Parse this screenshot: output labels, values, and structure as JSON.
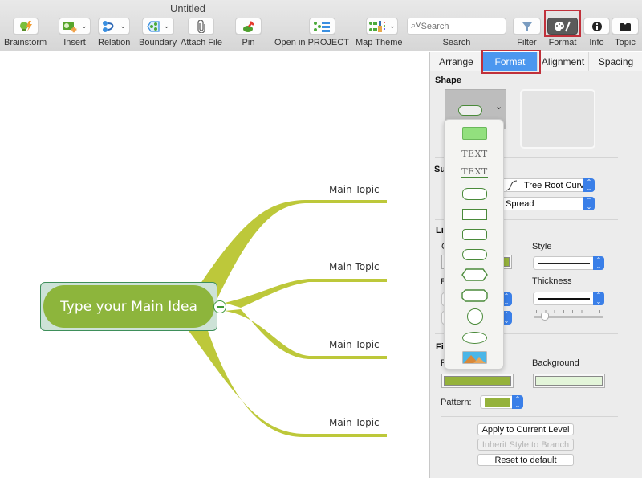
{
  "window": {
    "title": "Untitled"
  },
  "toolbar": {
    "items": [
      {
        "label": "Brainstorm",
        "icon": "brainstorm-icon"
      },
      {
        "label": "Insert",
        "icon": "insert-topic-icon",
        "has_menu": true
      },
      {
        "label": "Relation",
        "icon": "relation-icon",
        "has_menu": true
      },
      {
        "label": "Boundary",
        "icon": "boundary-icon",
        "has_menu": true
      },
      {
        "label": "Attach File",
        "icon": "paperclip-icon"
      },
      {
        "label": "Pin",
        "icon": "pin-icon"
      },
      {
        "label": "Open in PROJECT",
        "icon": "project-icon"
      },
      {
        "label": "Map Theme",
        "icon": "map-theme-icon",
        "has_menu": true
      }
    ],
    "search": {
      "label": "Search",
      "placeholder": "Search",
      "value": ""
    },
    "right_items": [
      {
        "label": "Filter",
        "icon": "filter-icon"
      },
      {
        "label": "Format",
        "icon": "palette-brush-icon",
        "active": true
      },
      {
        "label": "Info",
        "icon": "info-icon"
      },
      {
        "label": "Topic",
        "icon": "topic-icon"
      }
    ]
  },
  "mindmap": {
    "central_topic": "Type your Main Idea",
    "branches": [
      "Main Topic",
      "Main Topic",
      "Main Topic",
      "Main Topic"
    ],
    "colors": {
      "central_fill": "#8db53c",
      "branch": "#bdc83a",
      "selection": "#cde2d7"
    }
  },
  "panel": {
    "tabs": [
      {
        "label": "Arrange",
        "active": false
      },
      {
        "label": "Format",
        "active": true
      },
      {
        "label": "Alignment",
        "active": false
      },
      {
        "label": "Spacing",
        "active": false
      }
    ],
    "shape": {
      "title": "Shape",
      "options": [
        "filled-rectangle",
        "text",
        "underlined-text",
        "rounded-rectangle",
        "rectangle",
        "slightly-rounded-rectangle",
        "capsule",
        "hexagon",
        "octagon",
        "circle",
        "ellipse",
        "image"
      ],
      "option_text": "TEXT"
    },
    "subtopics": {
      "title": "Su",
      "line_style": "Tree Root Curve",
      "layout": "Spread"
    },
    "line": {
      "title": "Li",
      "color_label": "C",
      "style_label": "Style",
      "thickness_label": "Thickness",
      "end_label": "E",
      "thickness_level": 2,
      "thickness_steps": 8
    },
    "fill": {
      "title": "Fil",
      "fill_label": "F",
      "background_label": "Background",
      "fill_color": "#95b23b",
      "background_color": "#e3f5d9",
      "pattern_label": "Pattern:",
      "pattern_color": "#95b23b"
    },
    "buttons": {
      "apply": "Apply to Current Level",
      "inherit": "Inherit Style to Branch",
      "reset": "Reset to default"
    }
  }
}
